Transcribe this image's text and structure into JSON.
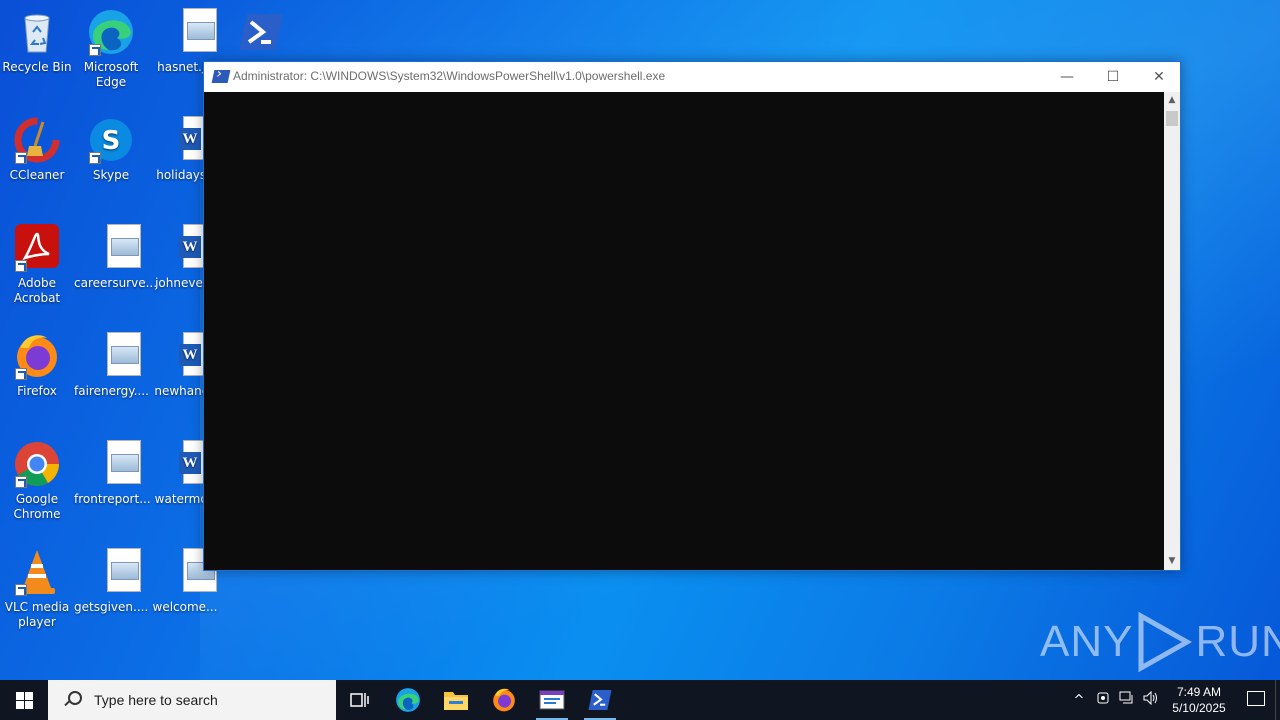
{
  "desktop": {
    "icons": [
      {
        "label": "Recycle Bin",
        "icon": "recycle-bin-icon"
      },
      {
        "label": "Microsoft Edge",
        "icon": "edge-icon"
      },
      {
        "label": "hasnet.jp",
        "icon": "image-file-icon"
      },
      {
        "label": "",
        "icon": "powershell-icon"
      },
      {
        "label": "CCleaner",
        "icon": "ccleaner-icon"
      },
      {
        "label": "Skype",
        "icon": "skype-icon"
      },
      {
        "label": "holidaysb",
        "icon": "word-doc-icon"
      },
      {
        "label": "Adobe Acrobat",
        "icon": "acrobat-icon"
      },
      {
        "label": "careersurve...",
        "icon": "image-file-icon"
      },
      {
        "label": "johnevery",
        "icon": "word-doc-icon"
      },
      {
        "label": "Firefox",
        "icon": "firefox-icon"
      },
      {
        "label": "fairenergy....",
        "icon": "image-file-icon"
      },
      {
        "label": "newhands",
        "icon": "word-doc-icon"
      },
      {
        "label": "Google Chrome",
        "icon": "chrome-icon"
      },
      {
        "label": "frontreport...",
        "icon": "image-file-icon"
      },
      {
        "label": "watermob",
        "icon": "word-doc-icon"
      },
      {
        "label": "VLC media player",
        "icon": "vlc-icon"
      },
      {
        "label": "getsgiven....",
        "icon": "image-file-icon"
      },
      {
        "label": "welcome...",
        "icon": "image-file-icon"
      }
    ]
  },
  "window": {
    "title": "Administrator: C:\\WINDOWS\\System32\\WindowsPowerShell\\v1.0\\powershell.exe",
    "minimize_glyph": "—",
    "maximize_glyph": "☐",
    "close_glyph": "✕",
    "scroll_up_glyph": "▲",
    "scroll_down_glyph": "▼"
  },
  "watermark": {
    "text_left": "ANY",
    "text_right": "RUN"
  },
  "taskbar": {
    "search_placeholder": "Type here to search",
    "apps": [
      "task-view-icon",
      "edge-icon",
      "file-explorer-icon",
      "firefox-icon",
      "media-app-icon",
      "powershell-icon"
    ],
    "clock_time": "7:49 AM",
    "clock_date": "5/10/2025",
    "tray_chevron": "^",
    "tray_volume": "🔊"
  },
  "colors": {
    "taskbar_bg": "#101522",
    "console_bg": "#0c0c0c",
    "accent": "#76b9ed"
  }
}
